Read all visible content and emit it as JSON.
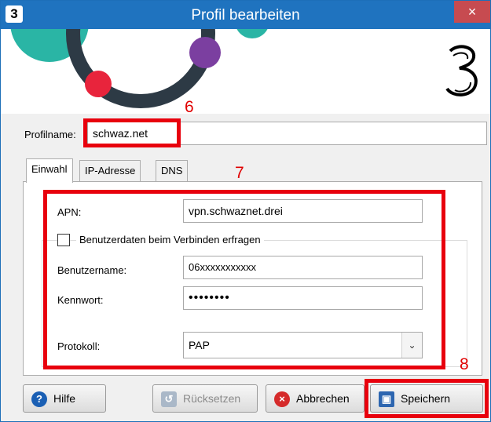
{
  "window": {
    "title": "Profil bearbeiten",
    "logo_glyph": "3",
    "close_glyph": "×"
  },
  "banner": {
    "brand_logo_glyph": "3",
    "colors": {
      "teal": "#2ab5a5",
      "purple": "#7b3fa0",
      "red": "#e8243c",
      "dark": "#2d3a45"
    }
  },
  "annotations": {
    "n6": "6",
    "n7": "7",
    "n8": "8"
  },
  "profile": {
    "label": "Profilname:",
    "value": "schwaz.net"
  },
  "tabs": [
    {
      "label": "Einwahl",
      "active": true
    },
    {
      "label": "IP-Adresse",
      "active": false
    },
    {
      "label": "DNS",
      "active": false
    }
  ],
  "form": {
    "apn_label": "APN:",
    "apn_value": "vpn.schwaznet.drei",
    "ask_credentials_label": "Benutzerdaten beim Verbinden erfragen",
    "ask_credentials_checked": false,
    "username_label": "Benutzername:",
    "username_value": "06xxxxxxxxxxx",
    "password_label": "Kennwort:",
    "password_value": "••••••••",
    "protocol_label": "Protokoll:",
    "protocol_value": "PAP",
    "dropdown_icon": "chevron-down-icon"
  },
  "buttons": {
    "help": {
      "label": "Hilfe",
      "icon": "help-icon"
    },
    "reset": {
      "label": "Rücksetzen",
      "icon": "reset-icon"
    },
    "cancel": {
      "label": "Abbrechen",
      "icon": "cancel-icon"
    },
    "save": {
      "label": "Speichern",
      "icon": "save-icon"
    }
  }
}
